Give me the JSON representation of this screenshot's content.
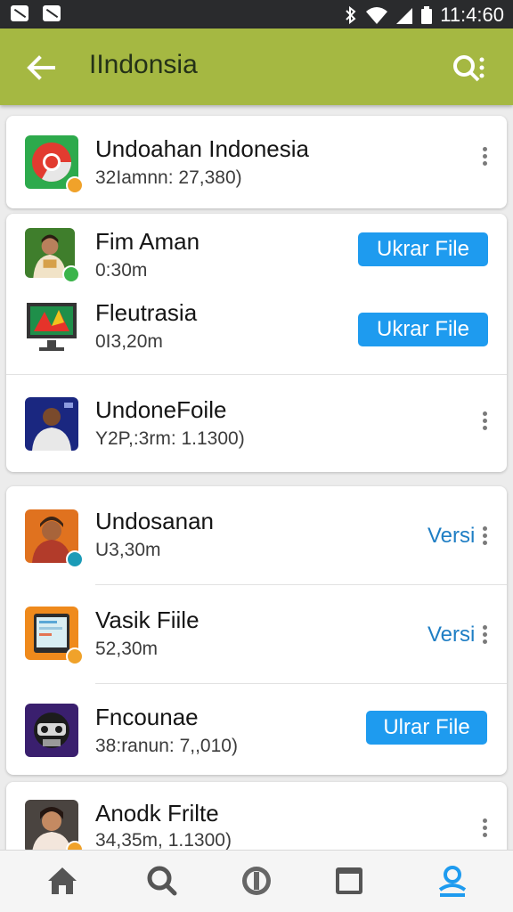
{
  "status_bar": {
    "time": "11:4:60",
    "icons": [
      "notification-icon",
      "image-icon",
      "bluetooth-icon",
      "wifi-icon",
      "signal-icon",
      "battery-icon"
    ]
  },
  "app_bar": {
    "title": "IIndonsia",
    "background": "#a5b842",
    "icons": [
      "back-arrow-icon",
      "search-icon"
    ]
  },
  "apps": [
    {
      "name": "Undoahan Indonesia",
      "meta": "32Iamnn: 27,380)",
      "icon": "chrome-app-icon",
      "action": ""
    },
    {
      "name": "Fim Aman",
      "meta": "0:30m",
      "icon": "person-photo-icon",
      "action": "Ukrar File"
    },
    {
      "name": "Fleutrasia",
      "meta": "0I3,20m",
      "icon": "monitor-app-icon",
      "action": "Ukrar File"
    },
    {
      "name": "UndoneFoile",
      "meta": "Y2P,:3rm: 1.1300)",
      "icon": "person-photo-icon",
      "action": ""
    },
    {
      "name": "Undosanan",
      "meta": "U3,30m",
      "icon": "person-photo-icon",
      "action": "Versi"
    },
    {
      "name": "Vasik Fiile",
      "meta": "52,30m",
      "icon": "tablet-app-icon",
      "action": "Versi"
    },
    {
      "name": "Fncounae",
      "meta": "38:ranun: 7,,010)",
      "icon": "robot-app-icon",
      "action": "Ulrar File"
    },
    {
      "name": "Anodk Frilte",
      "meta": "34,35m, 1.1300)",
      "icon": "person-photo-icon",
      "action": ""
    }
  ],
  "bottom_nav": {
    "items": [
      "home-icon",
      "search-icon",
      "updates-icon",
      "library-icon",
      "profile-icon"
    ],
    "active_color": "#1e9bef"
  },
  "colors": {
    "accent": "#1e9bef",
    "app_bar": "#a5b842",
    "link": "#1f7ec4"
  }
}
